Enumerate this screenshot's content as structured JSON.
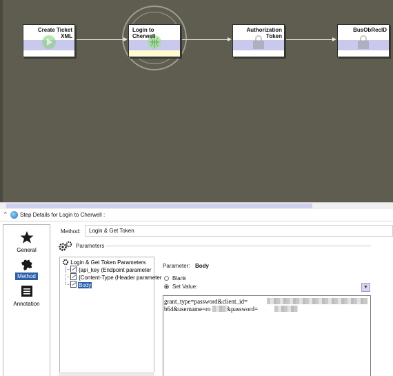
{
  "workflow": {
    "nodes": [
      {
        "title": "Create Ticket XML",
        "glyph": "play-icon",
        "active": false
      },
      {
        "title": "Login to Cherwell",
        "glyph": "globe-icon",
        "active": true
      },
      {
        "title": "Authorization Token",
        "glyph": "lock-icon",
        "active": false
      },
      {
        "title": "BusObRecID",
        "glyph": "lock-icon",
        "active": false
      }
    ]
  },
  "details": {
    "header": "Step Details for Login to Cherwell :",
    "nav": [
      {
        "label": "General",
        "icon": "star-icon",
        "selected": false
      },
      {
        "label": "Method",
        "icon": "puzzle-icon",
        "selected": true
      },
      {
        "label": "Annotation",
        "icon": "note-icon",
        "selected": false
      }
    ],
    "method_label": "Method:",
    "method_value": "Login & Get Token",
    "parameters_label": "Parameters",
    "tree": {
      "root": "Login & Get Token Parameters",
      "children": [
        {
          "label": "{api_key (Endpoint parameter",
          "selected": false
        },
        {
          "label": "{Content-Type (Header parameter",
          "selected": false
        },
        {
          "label": "Body",
          "selected": true
        }
      ]
    },
    "parameter_label": "Parameter:",
    "parameter_value": "Body",
    "options": [
      {
        "label": "Blank",
        "checked": false
      },
      {
        "label": "Set Value:",
        "checked": true
      }
    ],
    "value_text": "grant_type=password&client_id=\nb64&username=ro      x2&password="
  },
  "colors": {
    "canvas": "#5e5d4f",
    "node_band": "#c9c9ee",
    "selection": "#2b5fa8"
  }
}
